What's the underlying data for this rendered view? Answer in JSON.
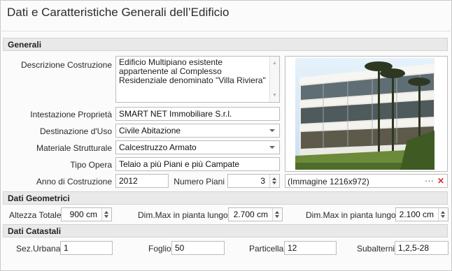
{
  "title": "Dati e Caratteristiche Generali dell’Edificio",
  "sections": {
    "generali": "Generali",
    "geometrici": "Dati Geometrici",
    "catastali": "Dati Catastali"
  },
  "generali": {
    "descrizione_label": "Descrizione Costruzione",
    "descrizione_value": "Edificio Multipiano esistente appartenente al Complesso Residenziale denominato \"Villa Riviera\"",
    "intestazione_label": "Intestazione Proprietà",
    "intestazione_value": "SMART NET Immobiliare S.r.l.",
    "destinazione_label": "Destinazione d'Uso",
    "destinazione_value": "Civile Abitazione",
    "materiale_label": "Materiale Strutturale",
    "materiale_value": "Calcestruzzo Armato",
    "tipo_label": "Tipo Opera",
    "tipo_value": "Telaio a più Piani e più Campate",
    "anno_label": "Anno di Costruzione",
    "anno_value": "2012",
    "piani_label": "Numero Piani",
    "piani_value": "3",
    "image_caption": "(Immagine 1216x972)",
    "more_glyph": "···",
    "clear_glyph": "✕"
  },
  "geometrici": {
    "altezza_label": "Altezza Totale",
    "altezza_value": "900 cm",
    "dimx_label": "Dim.Max in pianta lungo X",
    "dimx_value": "2.700 cm",
    "dimy_label": "Dim.Max in pianta lungo Y",
    "dimy_value": "2.100 cm"
  },
  "catastali": {
    "sez_label": "Sez.Urbana",
    "sez_value": "1",
    "foglio_label": "Foglio",
    "foglio_value": "50",
    "particella_label": "Particella",
    "particella_value": "12",
    "subalterni_label": "Subalterni",
    "subalterni_value": "1,2,5-28"
  },
  "icons": {
    "scroll_up": "scroll-up-arrow-icon",
    "scroll_down": "scroll-down-arrow-icon",
    "dropdown": "chevron-down-icon",
    "spin": "spin-updown-icon",
    "more": "more-dots-icon",
    "clear": "close-icon"
  },
  "colors": {
    "section_bg": "#e9e9e9",
    "field_border": "#bcbcbc",
    "clear_red": "#d9312b"
  }
}
